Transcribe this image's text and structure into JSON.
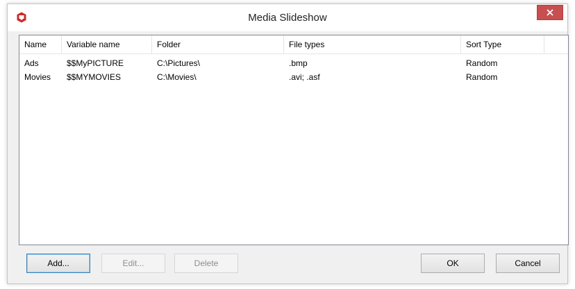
{
  "window": {
    "title": "Media Slideshow"
  },
  "colors": {
    "close_bg": "#c74f50",
    "app_icon": "#cc2a2a"
  },
  "columns": [
    "Name",
    "Variable name",
    "Folder",
    "File types",
    "Sort Type"
  ],
  "rows": [
    [
      "Ads",
      "$$MyPICTURE",
      "C:\\Pictures\\",
      ".bmp",
      "Random"
    ],
    [
      "Movies",
      "$$MYMOVIES",
      "C:\\Movies\\",
      ".avi; .asf",
      "Random"
    ]
  ],
  "buttons": {
    "add": "Add...",
    "edit": "Edit...",
    "delete": "Delete",
    "ok": "OK",
    "cancel": "Cancel"
  },
  "icons": {
    "app": "media-app-icon",
    "close": "close-icon"
  }
}
